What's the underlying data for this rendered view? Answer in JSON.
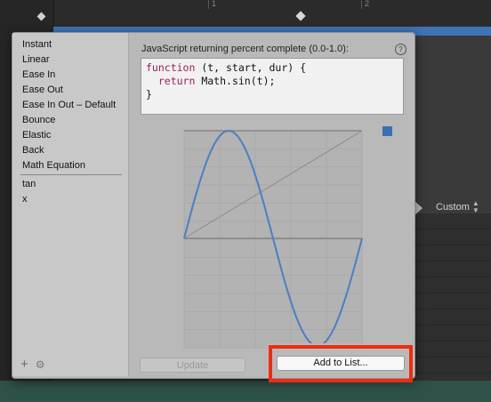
{
  "timeline": {
    "tick_labels": [
      "1",
      "2"
    ]
  },
  "inspector": {
    "custom_label": "Custom"
  },
  "sidebar": {
    "presets": [
      "Instant",
      "Linear",
      "Ease In",
      "Ease Out",
      "Ease In Out – Default",
      "Bounce",
      "Elastic",
      "Back",
      "Math Equation"
    ],
    "custom_items": [
      "tan",
      "x"
    ]
  },
  "editor": {
    "title": "JavaScript returning percent complete (0.0-1.0):",
    "help_symbol": "?",
    "code_lines": [
      [
        {
          "t": "function",
          "kw": true
        },
        {
          "t": " (t, start, dur) {",
          "kw": false
        }
      ],
      [
        {
          "t": "  ",
          "kw": false
        },
        {
          "t": "return",
          "kw": true
        },
        {
          "t": " Math.sin(t);",
          "kw": false
        }
      ],
      [
        {
          "t": "}",
          "kw": false
        }
      ]
    ]
  },
  "buttons": {
    "update_label": "Update",
    "add_label": "Add to List..."
  },
  "colors": {
    "curve": "#4a7fc1",
    "highlight": "#ef2c10",
    "keyword": "#9b1f5e"
  },
  "chart_data": {
    "type": "line",
    "title": "",
    "xlabel": "",
    "ylabel": "",
    "xlim": [
      0,
      1
    ],
    "ylim": [
      -1,
      1
    ],
    "grid": true,
    "series": [
      {
        "x": [
          0,
          0.1,
          0.2,
          0.3,
          0.4,
          0.5,
          0.6,
          0.7,
          0.8,
          0.9,
          1.0
        ],
        "values": [
          0,
          0.59,
          0.95,
          0.95,
          0.59,
          0,
          -0.59,
          -0.95,
          -0.95,
          -0.59,
          0
        ]
      },
      {
        "x": [
          0,
          1
        ],
        "values": [
          0,
          1
        ]
      }
    ]
  }
}
